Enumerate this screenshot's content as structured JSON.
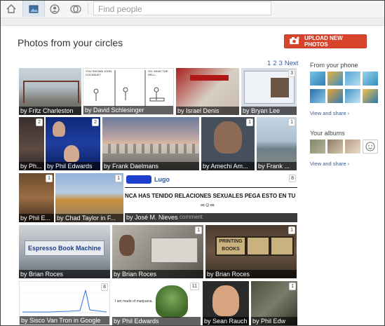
{
  "nav": {
    "search_placeholder": "Find people"
  },
  "page": {
    "title": "Photos from your circles",
    "upload_label": "UPLOAD NEW PHOTOS",
    "pager": [
      "1",
      "2",
      "3",
      "Next"
    ]
  },
  "sidebar": {
    "phone_heading": "From your phone",
    "phone_link": "View and share ›",
    "albums_heading": "Your albums",
    "albums_link": "View and share ›"
  },
  "photos": {
    "p1": {
      "caption": "by Fritz Charleston"
    },
    "p2": {
      "caption": "by David Schlesinger",
      "comic_text_1": "YOU SHOWN JOHN COCKBUE?",
      "comic_text_2": "OH, WHAT THE HELL."
    },
    "p3": {
      "caption": "by Israel Denis"
    },
    "p4": {
      "caption": "by Bryan Lee",
      "count": "3"
    },
    "p5": {
      "caption": "by Ph...",
      "count": "2"
    },
    "p6": {
      "caption": "by Phil Edwards",
      "count": "2"
    },
    "p7": {
      "caption": "by Frank Daelmans"
    },
    "p8": {
      "caption": "by Amechi Am...",
      "count": "1"
    },
    "p9": {
      "caption": "by Frank ...",
      "count": "1"
    },
    "p10": {
      "caption": "by Phil E...",
      "count": "1"
    },
    "p11": {
      "caption": "by Chad Taylor in F...",
      "count": "1"
    },
    "p12": {
      "caption": "by José M. Nieves",
      "count": "8",
      "post_name": "Lugo",
      "post_text": "NCA HAS TENIDO RELACIONES SEXUALES PEGA ESTO EN TU",
      "comment": "comment"
    },
    "p13": {
      "caption": "by Brian Roces",
      "sign": "Espresso Book Machine"
    },
    "p14": {
      "caption": "by Brian Roces",
      "count": "1"
    },
    "p15": {
      "caption": "by Brian Roces",
      "count": "1",
      "sign": "PRINTING BOOKS"
    },
    "p16": {
      "caption": "by Sisco Van Tron in Google",
      "count": "8"
    },
    "p17": {
      "caption": "by Phil Edwards",
      "count": "11",
      "quote": "I am made of marijuana."
    },
    "p18": {
      "caption": "by Sean Rauch"
    },
    "p19": {
      "caption": "by Phil Edw",
      "count": "1"
    }
  },
  "colors": {
    "accent_red": "#d8432c",
    "link_blue": "#2a5db0"
  }
}
